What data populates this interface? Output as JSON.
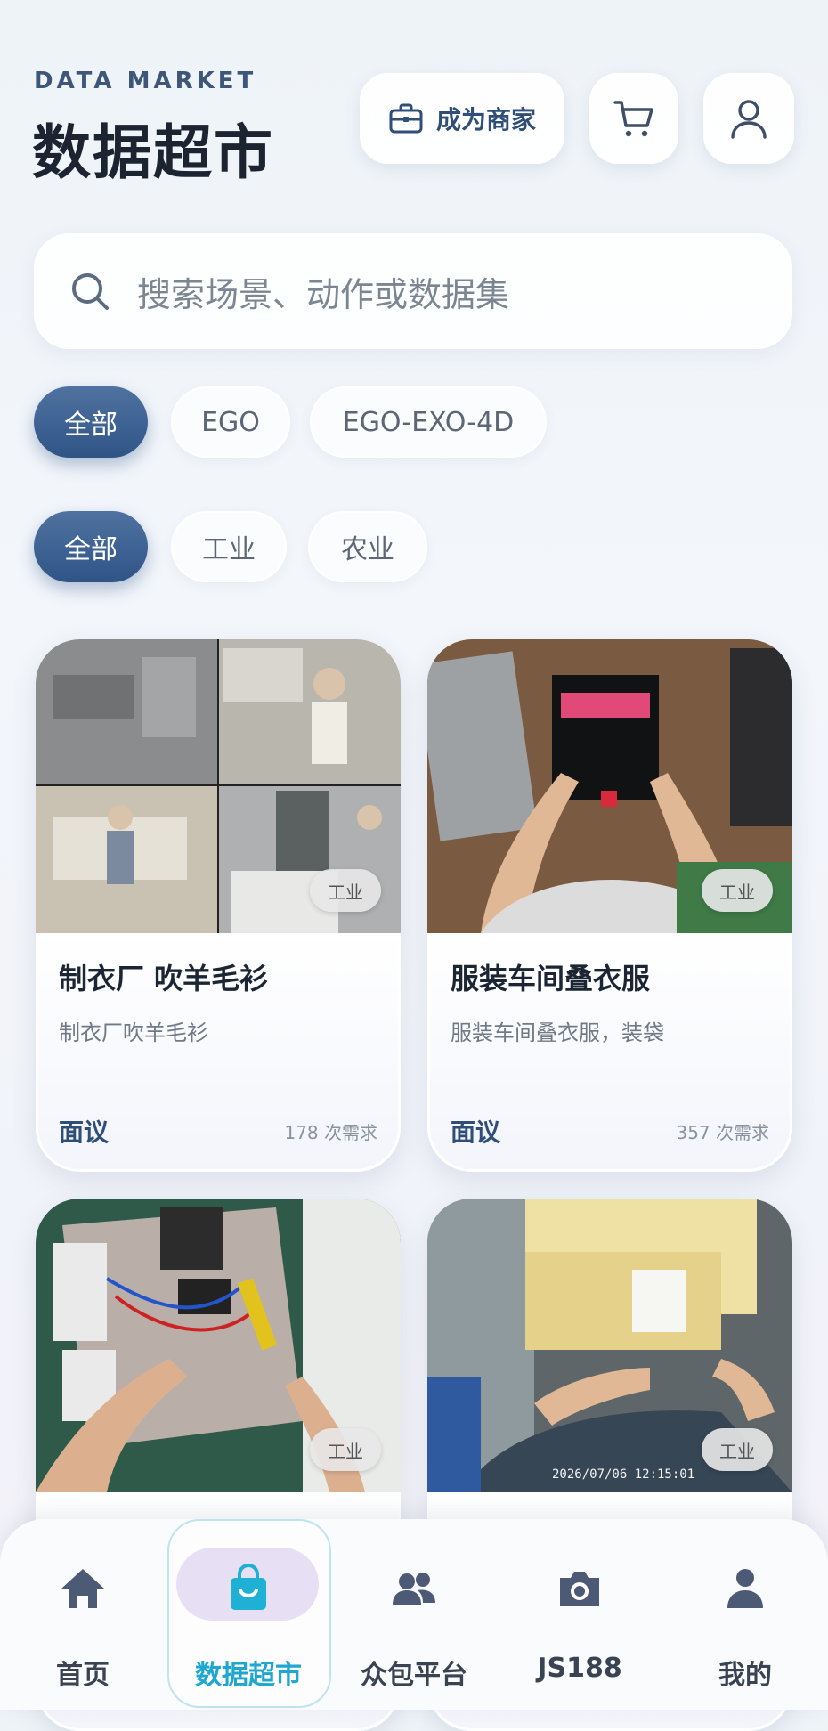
{
  "header": {
    "subtitle": "DATA MARKET",
    "title": "数据超市",
    "merchant_label": "成为商家"
  },
  "search": {
    "placeholder": "搜索场景、动作或数据集"
  },
  "filters": {
    "type_chips": [
      "全部",
      "EGO",
      "EGO-EXO-4D"
    ],
    "industry_chips": [
      "全部",
      "工业",
      "农业"
    ]
  },
  "cards": [
    {
      "title": "制衣厂 吹羊毛衫",
      "description": "制衣厂吹羊毛衫",
      "price": "面议",
      "demand": "178 次需求",
      "tag": "工业"
    },
    {
      "title": "服装车间叠衣服",
      "description": "服装车间叠衣服，装袋",
      "price": "面议",
      "demand": "357 次需求",
      "tag": "工业"
    },
    {
      "title": "",
      "description": "",
      "price": "",
      "demand": "",
      "tag": "工业",
      "timestamp": ""
    },
    {
      "title": "",
      "description": "",
      "price": "",
      "demand": "",
      "tag": "工业",
      "timestamp": "2026/07/06 12:15:01"
    }
  ],
  "nav": [
    {
      "label": "首页",
      "icon": "home-icon"
    },
    {
      "label": "数据超市",
      "icon": "shopping-bag-icon"
    },
    {
      "label": "众包平台",
      "icon": "users-icon"
    },
    {
      "label": "JS188",
      "icon": "camera-icon"
    },
    {
      "label": "我的",
      "icon": "person-icon"
    }
  ],
  "colors": {
    "accent": "#2f5486",
    "nav_active": "#1fa7cf",
    "nav_pill": "#e7e0f4"
  }
}
